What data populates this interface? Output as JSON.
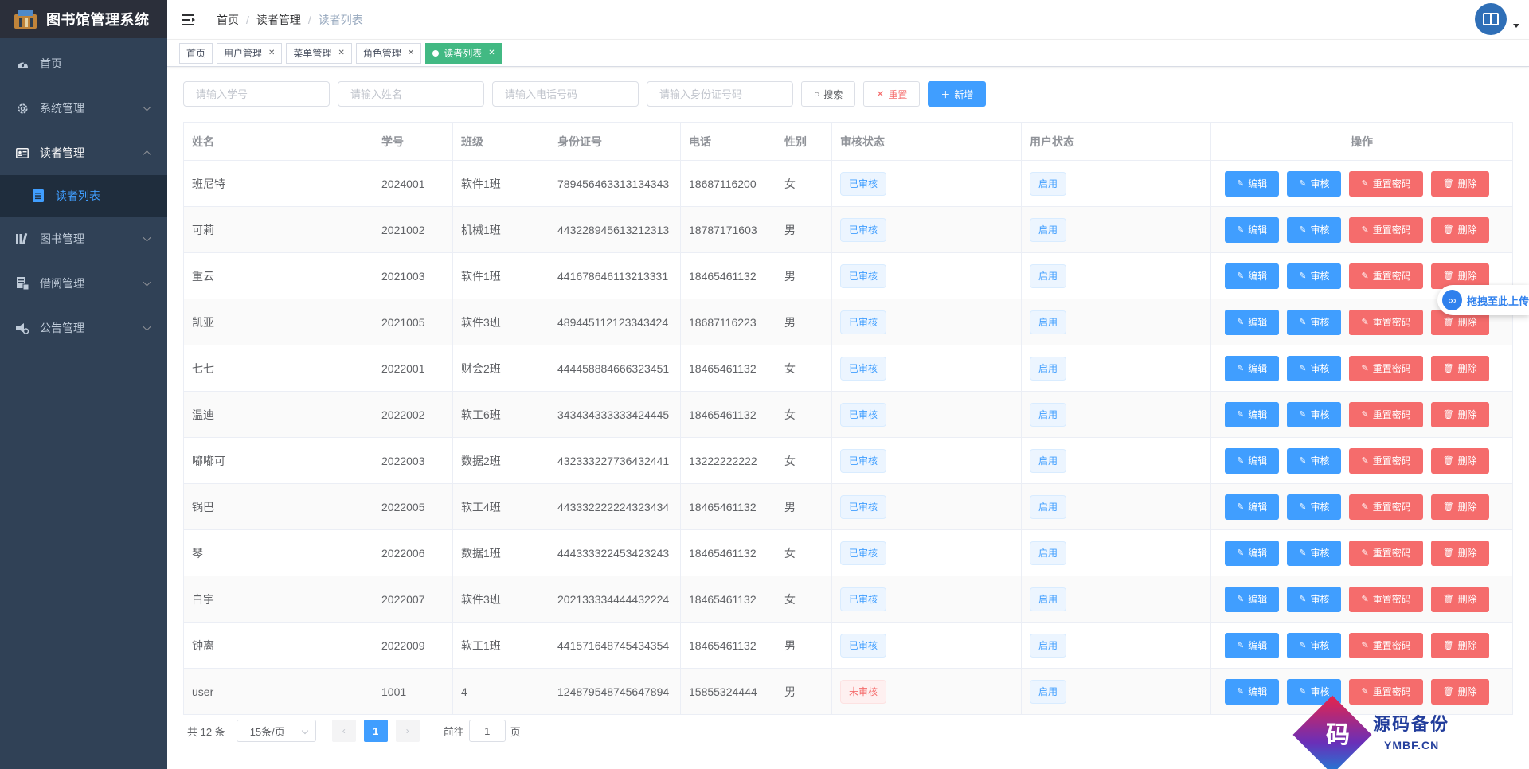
{
  "brand": {
    "title": "图书馆管理系统"
  },
  "sidebar": {
    "items": [
      {
        "label": "首页",
        "icon": "dashboard-icon"
      },
      {
        "label": "系统管理",
        "icon": "gear-icon"
      },
      {
        "label": "读者管理",
        "icon": "id-card-icon",
        "open": true
      },
      {
        "label": "图书管理",
        "icon": "books-icon"
      },
      {
        "label": "借阅管理",
        "icon": "document-icon"
      },
      {
        "label": "公告管理",
        "icon": "megaphone-icon"
      }
    ],
    "sub_items": [
      {
        "label": "读者列表",
        "icon": "list-icon"
      }
    ]
  },
  "breadcrumb": [
    "首页",
    "读者管理",
    "读者列表"
  ],
  "tags": [
    {
      "label": "首页",
      "closable": false
    },
    {
      "label": "用户管理",
      "closable": true
    },
    {
      "label": "菜单管理",
      "closable": true
    },
    {
      "label": "角色管理",
      "closable": true
    },
    {
      "label": "读者列表",
      "closable": true,
      "active": true
    }
  ],
  "search": {
    "student_no_placeholder": "请输入学号",
    "name_placeholder": "请输入姓名",
    "phone_placeholder": "请输入电话号码",
    "idcard_placeholder": "请输入身份证号码",
    "search_label": "搜索",
    "reset_label": "重置",
    "add_label": "新增"
  },
  "table": {
    "columns": [
      "姓名",
      "学号",
      "班级",
      "身份证号",
      "电话",
      "性别",
      "审核状态",
      "用户状态",
      "操作"
    ],
    "actions": {
      "edit": "编辑",
      "audit": "审核",
      "reset_pwd": "重置密码",
      "delete": "删除"
    },
    "rows": [
      {
        "name": "班尼特",
        "no": "2024001",
        "cls": "软件1班",
        "idcard": "789456463313134343",
        "phone": "18687116200",
        "gender": "女",
        "audit": "已审核",
        "audited": true,
        "status": "启用"
      },
      {
        "name": "可莉",
        "no": "2021002",
        "cls": "机械1班",
        "idcard": "443228945613212313",
        "phone": "18787171603",
        "gender": "男",
        "audit": "已审核",
        "audited": true,
        "status": "启用"
      },
      {
        "name": "重云",
        "no": "2021003",
        "cls": "软件1班",
        "idcard": "441678646113213331",
        "phone": "18465461132",
        "gender": "男",
        "audit": "已审核",
        "audited": true,
        "status": "启用"
      },
      {
        "name": "凯亚",
        "no": "2021005",
        "cls": "软件3班",
        "idcard": "489445112123343424",
        "phone": "18687116223",
        "gender": "男",
        "audit": "已审核",
        "audited": true,
        "status": "启用"
      },
      {
        "name": "七七",
        "no": "2022001",
        "cls": "财会2班",
        "idcard": "444458884666323451",
        "phone": "18465461132",
        "gender": "女",
        "audit": "已审核",
        "audited": true,
        "status": "启用"
      },
      {
        "name": "温迪",
        "no": "2022002",
        "cls": "软工6班",
        "idcard": "343434333333424445",
        "phone": "18465461132",
        "gender": "女",
        "audit": "已审核",
        "audited": true,
        "status": "启用"
      },
      {
        "name": "嘟嘟可",
        "no": "2022003",
        "cls": "数据2班",
        "idcard": "432333227736432441",
        "phone": "13222222222",
        "gender": "女",
        "audit": "已审核",
        "audited": true,
        "status": "启用"
      },
      {
        "name": "锅巴",
        "no": "2022005",
        "cls": "软工4班",
        "idcard": "443332222224323434",
        "phone": "18465461132",
        "gender": "男",
        "audit": "已审核",
        "audited": true,
        "status": "启用"
      },
      {
        "name": "琴",
        "no": "2022006",
        "cls": "数据1班",
        "idcard": "444333322453423243",
        "phone": "18465461132",
        "gender": "女",
        "audit": "已审核",
        "audited": true,
        "status": "启用"
      },
      {
        "name": "白宇",
        "no": "2022007",
        "cls": "软件3班",
        "idcard": "202133334444432224",
        "phone": "18465461132",
        "gender": "女",
        "audit": "已审核",
        "audited": true,
        "status": "启用"
      },
      {
        "name": "钟离",
        "no": "2022009",
        "cls": "软工1班",
        "idcard": "441571648745434354",
        "phone": "18465461132",
        "gender": "男",
        "audit": "已审核",
        "audited": true,
        "status": "启用"
      },
      {
        "name": "user",
        "no": "1001",
        "cls": "4",
        "idcard": "124879548745647894",
        "phone": "15855324444",
        "gender": "男",
        "audit": "未审核",
        "audited": false,
        "status": "启用"
      }
    ]
  },
  "pagination": {
    "total": "共 12 条",
    "page_size": "15条/页",
    "current_page": "1",
    "goto_prefix": "前往",
    "goto_value": "1",
    "goto_suffix": "页"
  },
  "float_upload": {
    "label": "拖拽至此上传"
  },
  "watermark": {
    "char": "码",
    "text": "源码备份",
    "sub": "YMBF.CN"
  },
  "colors": {
    "sidebar_bg": "#304156",
    "primary": "#409eff",
    "danger": "#f56c6c",
    "active_tag": "#42b983"
  }
}
